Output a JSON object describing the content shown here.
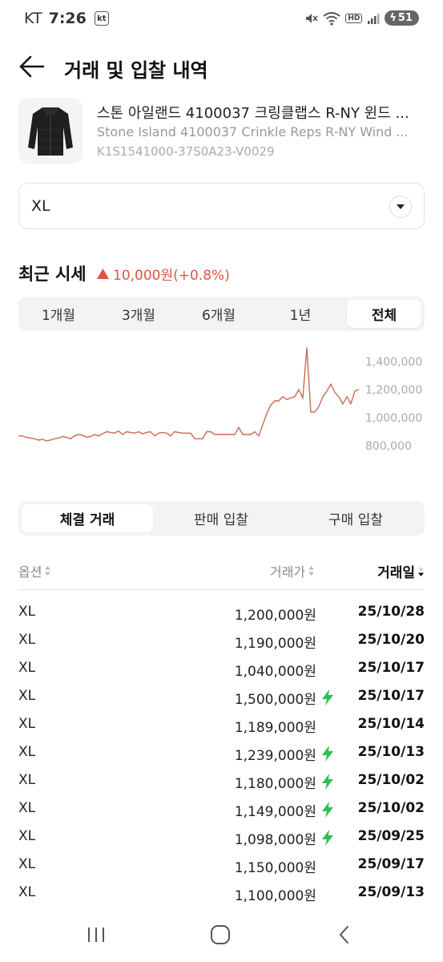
{
  "status_bar": {
    "carrier": "KT",
    "time": "7:26",
    "carrier_badge": "kt",
    "hd_label": "HD",
    "battery": "51"
  },
  "header": {
    "title": "거래 및 입찰 내역"
  },
  "product": {
    "name_ko": "스톤 아일랜드 4100037 크링클랩스 R-NY 윈드 ...",
    "name_en": "Stone Island 4100037 Crinkle Reps R-NY Wind ...",
    "code": "K1S1541000-37S0A23-V0029"
  },
  "size_select": {
    "value": "XL"
  },
  "recent_price": {
    "title": "최근 시세",
    "change": "10,000원(+0.8%)",
    "direction": "up",
    "color": "#e0533f"
  },
  "period_tabs": [
    {
      "label": "1개월",
      "active": false
    },
    {
      "label": "3개월",
      "active": false
    },
    {
      "label": "6개월",
      "active": false
    },
    {
      "label": "1년",
      "active": false
    },
    {
      "label": "전체",
      "active": true
    }
  ],
  "chart_data": {
    "type": "line",
    "series": [
      {
        "values": [
          870000,
          870000,
          860000,
          855000,
          850000,
          840000,
          845000,
          835000,
          840000,
          850000,
          855000,
          865000,
          860000,
          850000,
          870000,
          880000,
          875000,
          860000,
          865000,
          880000,
          870000,
          885000,
          900000,
          895000,
          890000,
          905000,
          880000,
          900000,
          895000,
          890000,
          900000,
          885000,
          895000,
          900000,
          870000,
          890000,
          895000,
          890000,
          870000,
          900000,
          895000,
          890000,
          890000,
          890000,
          850000,
          850000,
          850000,
          900000,
          900000,
          880000,
          880000,
          880000,
          880000,
          880000,
          880000,
          930000,
          880000,
          880000,
          880000,
          900000,
          870000,
          950000,
          1030000,
          1090000,
          1120000,
          1120000,
          1150000,
          1130000,
          1140000,
          1150000,
          1200000,
          1140000,
          1500000,
          1040000,
          1040000,
          1080000,
          1150000,
          1189000,
          1239000,
          1180000,
          1149000,
          1098000,
          1150000,
          1100000,
          1190000,
          1200000
        ]
      }
    ],
    "y_ticks": [
      "1,400,000",
      "1,200,000",
      "1,000,000",
      "800,000"
    ],
    "ylim": [
      720000,
      1520000
    ],
    "line_color": "#c96b57"
  },
  "trade_tabs": [
    {
      "label": "체결 거래",
      "active": true
    },
    {
      "label": "판매 입찰",
      "active": false
    },
    {
      "label": "구매 입찰",
      "active": false
    }
  ],
  "table": {
    "headers": {
      "option": "옵션",
      "price": "거래가",
      "date": "거래일"
    },
    "rows": [
      {
        "option": "XL",
        "price": "1,200,000원",
        "quick": false,
        "date": "25/10/28"
      },
      {
        "option": "XL",
        "price": "1,190,000원",
        "quick": false,
        "date": "25/10/20"
      },
      {
        "option": "XL",
        "price": "1,040,000원",
        "quick": false,
        "date": "25/10/17"
      },
      {
        "option": "XL",
        "price": "1,500,000원",
        "quick": true,
        "date": "25/10/17"
      },
      {
        "option": "XL",
        "price": "1,189,000원",
        "quick": false,
        "date": "25/10/14"
      },
      {
        "option": "XL",
        "price": "1,239,000원",
        "quick": true,
        "date": "25/10/13"
      },
      {
        "option": "XL",
        "price": "1,180,000원",
        "quick": true,
        "date": "25/10/02"
      },
      {
        "option": "XL",
        "price": "1,149,000원",
        "quick": true,
        "date": "25/10/02"
      },
      {
        "option": "XL",
        "price": "1,098,000원",
        "quick": true,
        "date": "25/09/25"
      },
      {
        "option": "XL",
        "price": "1,150,000원",
        "quick": false,
        "date": "25/09/17"
      },
      {
        "option": "XL",
        "price": "1,100,000원",
        "quick": false,
        "date": "25/09/13"
      }
    ]
  },
  "colors": {
    "bolt": "#2dbf52",
    "up": "#e0533f"
  }
}
